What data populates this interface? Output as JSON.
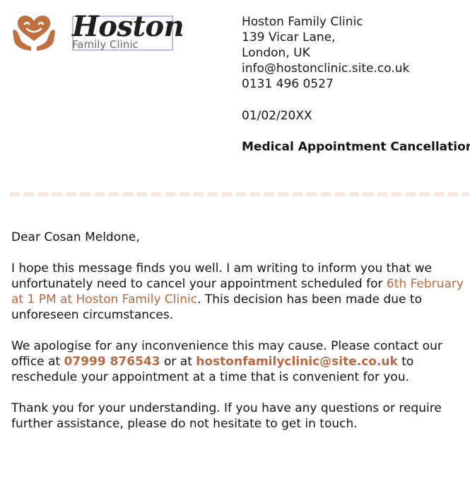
{
  "brand": {
    "name": "Hoston",
    "tagline": "Family Clinic",
    "accent_color": "#c0703f",
    "logo_icon": "hands-holding-heart-icon"
  },
  "sender": {
    "name": "Hoston Family Clinic",
    "street": "139 Vicar Lane,",
    "city": "London, UK",
    "email": "info@hostonclinic.site.co.uk",
    "phone": "0131 496 0527"
  },
  "date": "01/02/20XX",
  "subject": "Medical Appointment Cancellation",
  "letter": {
    "greeting": "Dear Cosan Meldone,",
    "p1_before": "I hope this message finds you well. I am writing to inform you that we unfortunately need to cancel your appointment scheduled for ",
    "p1_highlight": "6th February at 1 PM at Hoston Family Clinic",
    "p1_after": ". This decision has been made due to unforeseen circumstances.",
    "p2_before": "We apologise for any inconvenience this may cause. Please contact our office at ",
    "p2_phone": "07999 876543",
    "p2_middle": " or at ",
    "p2_email": "hostonfamilyclinic@site.co.uk",
    "p2_after": " to reschedule your appointment at a time that is convenient for you.",
    "p3": "Thank you for your understanding. If you have any questions or require further assistance, please do not hesitate to get in touch."
  }
}
